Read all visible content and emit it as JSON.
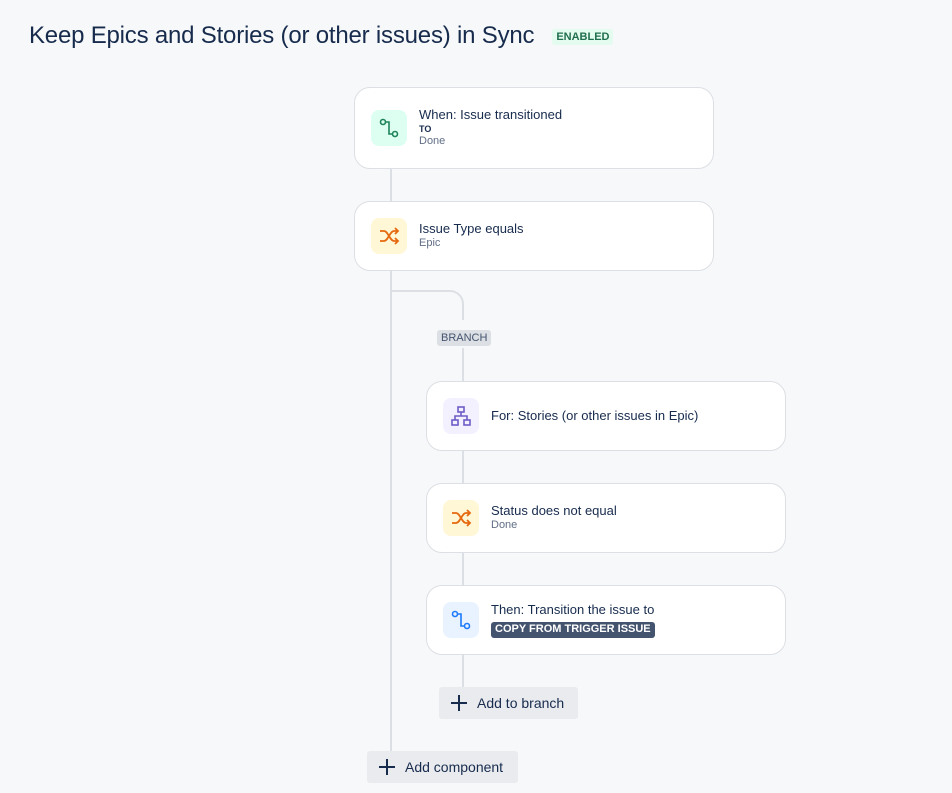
{
  "header": {
    "title": "Keep Epics and Stories (or other issues) in Sync",
    "status_badge": "ENABLED"
  },
  "components": [
    {
      "main": "When: Issue transitioned",
      "to_label": "TO",
      "sub": "Done",
      "icon": "transition-icon",
      "accent": "#1f845a"
    },
    {
      "main": "Issue Type equals",
      "sub": "Epic",
      "icon": "shuffle-icon",
      "accent": "#e56910"
    }
  ],
  "branch": {
    "tag": "BRANCH",
    "components": [
      {
        "main": "For: Stories (or other issues in Epic)",
        "icon": "hierarchy-icon",
        "accent": "#6e5dc6"
      },
      {
        "main": "Status does not equal",
        "sub": "Done",
        "icon": "shuffle-icon",
        "accent": "#e56910"
      },
      {
        "main": "Then: Transition the issue to",
        "lozenge": "COPY FROM TRIGGER ISSUE",
        "icon": "transition-icon",
        "accent": "#1d7afc"
      }
    ],
    "add_label": "Add to branch"
  },
  "add_component_label": "Add component"
}
